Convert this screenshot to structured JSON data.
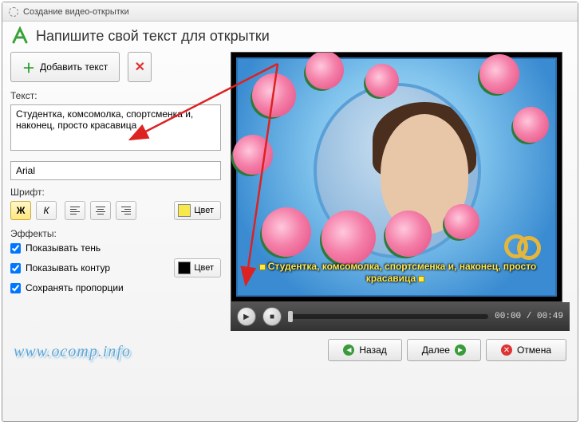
{
  "window": {
    "title": "Создание видео-открытки"
  },
  "header": {
    "title": "Напишите свой текст для открытки"
  },
  "toolbar": {
    "add_label": "Добавить текст"
  },
  "text_section": {
    "label": "Текст:",
    "value": "Студентка, комсомолка, спортсменка и, наконец, просто красавица"
  },
  "font": {
    "value": "Arial"
  },
  "format": {
    "label": "Шрифт:",
    "bold": "Ж",
    "italic": "К",
    "color_label": "Цвет",
    "text_color": "#f7e94a"
  },
  "effects": {
    "label": "Эффекты:",
    "shadow": "Показывать тень",
    "outline": "Показывать контур",
    "outline_color_label": "Цвет",
    "outline_color": "#000000",
    "keep_ratio": "Сохранять пропорции"
  },
  "preview": {
    "caption": "Студентка, комсомолка, спортсменка и, наконец, просто красавица"
  },
  "player": {
    "time_current": "00:00",
    "time_total": "00:49"
  },
  "footer": {
    "watermark": "www.ocomp.info",
    "back": "Назад",
    "next": "Далее",
    "cancel": "Отмена"
  }
}
